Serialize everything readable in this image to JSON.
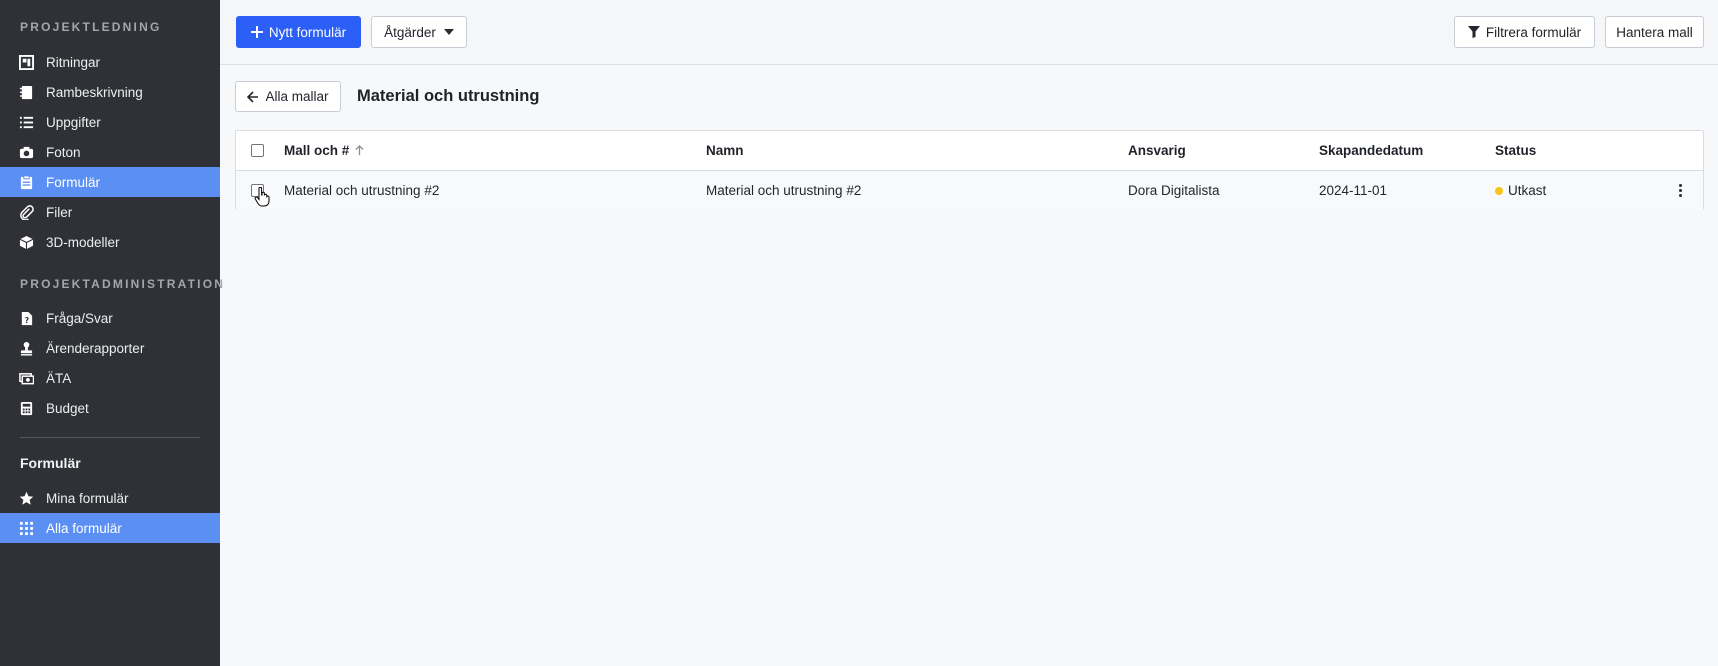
{
  "sidebar": {
    "section1_title": "PROJEKTLEDNING",
    "section1_items": [
      {
        "label": "Ritningar",
        "icon": "blueprint-icon"
      },
      {
        "label": "Rambeskrivning",
        "icon": "notebook-icon"
      },
      {
        "label": "Uppgifter",
        "icon": "list-icon"
      },
      {
        "label": "Foton",
        "icon": "camera-icon"
      },
      {
        "label": "Formulär",
        "icon": "clipboard-icon",
        "active": true
      },
      {
        "label": "Filer",
        "icon": "paperclip-icon"
      },
      {
        "label": "3D-modeller",
        "icon": "cube-icon"
      }
    ],
    "section2_title": "PROJEKTADMINISTRATION",
    "section2_items": [
      {
        "label": "Fråga/Svar",
        "icon": "file-question-icon"
      },
      {
        "label": "Ärenderapporter",
        "icon": "stamp-icon"
      },
      {
        "label": "ÄTA",
        "icon": "money-icon"
      },
      {
        "label": "Budget",
        "icon": "calculator-icon"
      }
    ],
    "forms_heading": "Formulär",
    "forms_items": [
      {
        "label": "Mina formulär",
        "icon": "star-icon"
      },
      {
        "label": "Alla formulär",
        "icon": "grid-icon",
        "active": true
      }
    ]
  },
  "toolbar": {
    "new_form": "Nytt formulär",
    "actions": "Åtgärder",
    "filter_forms": "Filtrera formulär",
    "manage_template": "Hantera mall"
  },
  "main": {
    "back_label": "Alla mallar",
    "title": "Material och utrustning",
    "table": {
      "columns": [
        "Mall och #",
        "Namn",
        "Ansvarig",
        "Skapandedatum",
        "Status"
      ],
      "rows": [
        {
          "template": "Material och utrustning #2",
          "name": "Material och utrustning #2",
          "responsible": "Dora Digitalista",
          "created": "2024-11-01",
          "status": "Utkast",
          "status_color": "#f5c518"
        }
      ]
    }
  },
  "colors": {
    "primary": "#2b5ff5",
    "sidebar_bg": "#2f3136",
    "sidebar_active": "#5b8ff4"
  }
}
